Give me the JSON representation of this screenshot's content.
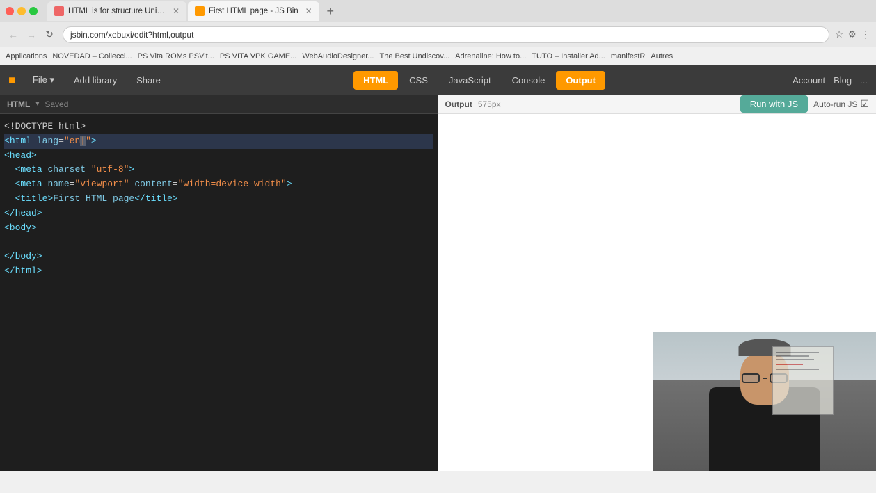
{
  "browser": {
    "tabs": [
      {
        "id": "tab1",
        "label": "HTML is for structure Unit | Ja...",
        "icon_type": "html",
        "active": false,
        "url": ""
      },
      {
        "id": "tab2",
        "label": "First HTML page - JS Bin",
        "icon_type": "jsbin",
        "active": true,
        "url": "jsbin.com/xebuxi/edit?html,output"
      }
    ],
    "new_tab_label": "+",
    "url": "jsbin.com/xebuxi/edit?html,output",
    "bookmarks": [
      "Applications",
      "NOVEDAD – Collecci...",
      "PS Vita ROMs PSVit...",
      "PS VITA VPK GAME...",
      "WebAudioDesigner...",
      "The Best Undiscov...",
      "Adrenaline: How to...",
      "TUTO – Installer Ad...",
      "manifestR",
      "Autres"
    ]
  },
  "jsbin": {
    "logo": "JS Bin",
    "toolbar": {
      "file_label": "File",
      "file_dropdown": "▾",
      "add_library_label": "Add library",
      "share_label": "Share"
    },
    "panel_tabs": [
      {
        "id": "html",
        "label": "HTML",
        "active": true
      },
      {
        "id": "css",
        "label": "CSS",
        "active": false
      },
      {
        "id": "javascript",
        "label": "JavaScript",
        "active": false
      },
      {
        "id": "console",
        "label": "Console",
        "active": false
      },
      {
        "id": "output",
        "label": "Output",
        "active": true
      }
    ],
    "top_right": {
      "account_label": "Account",
      "blog_label": "Blog"
    },
    "run_button_label": "Run with JS",
    "auto_run_label": "Auto-run JS",
    "code_panel": {
      "title": "HTML",
      "dropdown_icon": "▾",
      "saved_label": "Saved"
    },
    "output_panel": {
      "title": "Output",
      "size": "575px"
    },
    "code_lines": [
      {
        "text": "<!DOCTYPE html>",
        "indent": 0,
        "type": "doctype"
      },
      {
        "text": "<html lang=\"en\">",
        "indent": 0,
        "type": "tag",
        "selected": true
      },
      {
        "text": "<head>",
        "indent": 0,
        "type": "tag"
      },
      {
        "text": "  <meta charset=\"utf-8\">",
        "indent": 1,
        "type": "tag"
      },
      {
        "text": "  <meta name=\"viewport\" content=\"width=device-width\">",
        "indent": 1,
        "type": "tag"
      },
      {
        "text": "  <title>First HTML page</title>",
        "indent": 1,
        "type": "mixed"
      },
      {
        "text": "</head>",
        "indent": 0,
        "type": "tag"
      },
      {
        "text": "<body>",
        "indent": 0,
        "type": "tag"
      },
      {
        "text": "",
        "indent": 0,
        "type": "empty"
      },
      {
        "text": "</body>",
        "indent": 0,
        "type": "tag"
      },
      {
        "text": "</html>",
        "indent": 0,
        "type": "tag"
      }
    ]
  }
}
